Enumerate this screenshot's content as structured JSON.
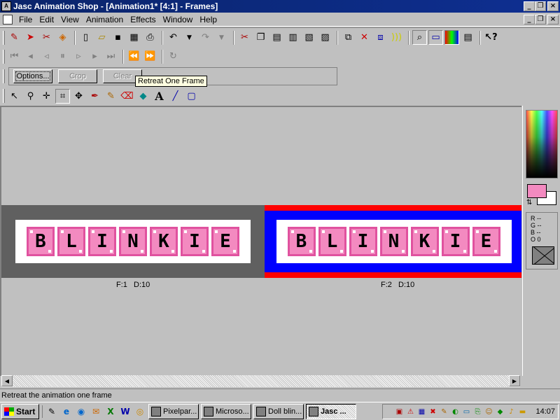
{
  "window": {
    "title": "Jasc Animation Shop - [Animation1* [4:1] - Frames]",
    "controls": [
      "_",
      "❐",
      "×"
    ]
  },
  "menu": {
    "items": [
      "File",
      "Edit",
      "View",
      "Animation",
      "Effects",
      "Window",
      "Help"
    ]
  },
  "toolbar1": {
    "icons": [
      "animation-wizard-icon",
      "banner-wizard-icon",
      "optimization-wizard-icon",
      "palette-icon",
      "new-icon",
      "open-icon",
      "save-icon",
      "save-all-icon",
      "print-icon",
      "undo-icon",
      "redo-icon",
      "cut-icon",
      "copy-icon",
      "paste-icon",
      "paste-before-icon",
      "paste-after-icon",
      "paste-into-icon",
      "insert-frames-icon",
      "delete-frames-icon",
      "frame-properties-icon",
      "view-animation-icon",
      "zoom-icon",
      "frame-view-icon",
      "color-view-icon",
      "film-strip-icon",
      "help-icon"
    ]
  },
  "toolbar2": {
    "icons": [
      "first-frame-icon",
      "previous-frame-icon",
      "retreat-one-frame-icon",
      "pause-icon",
      "play-icon",
      "next-frame-icon",
      "last-frame-icon",
      "rewind-icon",
      "advance-icon",
      "refresh-icon"
    ]
  },
  "toolbar3": {
    "options_label": "Options...",
    "crop_label": "Crop",
    "clear_label": "Clear"
  },
  "tooltip": "Retreat One Frame",
  "toolbar4": {
    "icons": [
      "arrow-tool-icon",
      "zoom-tool-icon",
      "mover-tool-icon",
      "crop-tool-icon",
      "move-tool-icon",
      "dropper-tool-icon",
      "paintbrush-tool-icon",
      "eraser-tool-icon",
      "fill-tool-icon",
      "text-tool-icon",
      "line-tool-icon",
      "shape-tool-icon"
    ]
  },
  "frames": [
    {
      "label": "F:1   D:10",
      "letters": [
        "B",
        "L",
        "I",
        "N",
        "K",
        "I",
        "E"
      ]
    },
    {
      "label": "F:2   D:10",
      "letters": [
        "B",
        "L",
        "I",
        "N",
        "K",
        "I",
        "E"
      ]
    }
  ],
  "palette": {
    "rgb": [
      "R --",
      "G --",
      "B --",
      "O  0"
    ],
    "foreground": "#f38ac0",
    "background": "#ffffff"
  },
  "status": "Retreat the animation one frame",
  "taskbar": {
    "start": "Start",
    "tasks": [
      "Pixelpar...",
      "Microso...",
      "Doll blin...",
      "Jasc ..."
    ],
    "clock": "14:07"
  }
}
